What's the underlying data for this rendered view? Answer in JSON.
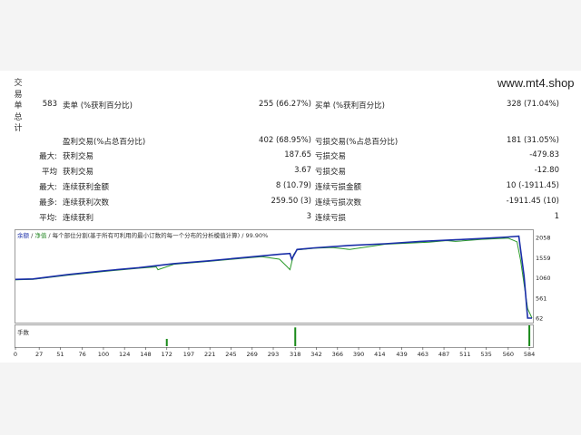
{
  "watermark": "www.mt4.shop",
  "side_label": "交易单总计",
  "stats": {
    "rows": [
      {
        "l1": "583",
        "l2": "卖单 (%获利百分比)",
        "v1": "255 (66.27%)",
        "l3": "买单 (%获利百分比)",
        "v2": "328 (71.04%)"
      },
      {
        "l1": "",
        "l2": "盈利交易(%占总百分比)",
        "v1": "402 (68.95%)",
        "l3": "亏损交易(%占总百分比)",
        "v2": "181 (31.05%)"
      },
      {
        "l1": "最大:",
        "l2": "获利交易",
        "v1": "187.65",
        "l3": "亏损交易",
        "v2": "-479.83"
      },
      {
        "l1": "平均",
        "l2": "获利交易",
        "v1": "3.67",
        "l3": "亏损交易",
        "v2": "-12.80"
      },
      {
        "l1": "最大:",
        "l2": "连续获利金额",
        "v1": "8 (10.79)",
        "l3": "连续亏损金额",
        "v2": "10 (-1911.45)"
      },
      {
        "l1": "最多:",
        "l2": "连续获利次数",
        "v1": "259.50 (3)",
        "l3": "连续亏损次数",
        "v2": "-1911.45 (10)"
      },
      {
        "l1": "平均:",
        "l2": "连续获利",
        "v1": "3",
        "l3": "连续亏损",
        "v2": "1"
      }
    ]
  },
  "legend": {
    "balance": "余额",
    "sep1": " / ",
    "equity": "净值",
    "rest": " / 每个部位分割(基于所有可利用的最小订数的每一个分布的分析模值计算) / 99.90%"
  },
  "volume_label": "手数",
  "colors": {
    "balance": "#1a2ea8",
    "equity": "#2a9a2a",
    "volume": "#1a8a1a"
  },
  "chart_data": {
    "type": "line",
    "ylim": [
      62,
      2058
    ],
    "yticks": [
      2058,
      1559,
      1060,
      561,
      62
    ],
    "xticks": [
      0,
      27,
      51,
      76,
      100,
      124,
      148,
      172,
      197,
      221,
      245,
      269,
      293,
      318,
      342,
      366,
      390,
      414,
      439,
      463,
      487,
      511,
      535,
      560,
      584
    ],
    "xlim": [
      0,
      587
    ],
    "series": [
      {
        "name": "余额",
        "x": [
          0,
          20,
          60,
          100,
          140,
          180,
          220,
          260,
          300,
          312,
          314,
          320,
          340,
          380,
          420,
          460,
          500,
          530,
          560,
          572,
          578,
          582,
          587
        ],
        "y": [
          1020,
          1030,
          1140,
          1230,
          1310,
          1410,
          1480,
          1560,
          1640,
          1660,
          1520,
          1760,
          1800,
          1860,
          1900,
          1960,
          2000,
          2030,
          2070,
          2090,
          1100,
          62,
          62
        ]
      },
      {
        "name": "净值",
        "x": [
          0,
          20,
          60,
          100,
          140,
          160,
          162,
          180,
          220,
          260,
          280,
          300,
          308,
          312,
          316,
          320,
          340,
          360,
          380,
          420,
          470,
          490,
          500,
          530,
          560,
          570,
          574,
          578,
          582,
          587
        ],
        "y": [
          1010,
          1022,
          1125,
          1215,
          1295,
          1330,
          1260,
          1395,
          1465,
          1545,
          1580,
          1520,
          1350,
          1260,
          1630,
          1750,
          1790,
          1810,
          1760,
          1890,
          1940,
          1980,
          1960,
          2010,
          2040,
          1950,
          1500,
          900,
          300,
          62
        ]
      }
    ],
    "volume": {
      "x": [
        172,
        318,
        584
      ],
      "y": [
        0.35,
        0.9,
        1.0
      ]
    }
  }
}
